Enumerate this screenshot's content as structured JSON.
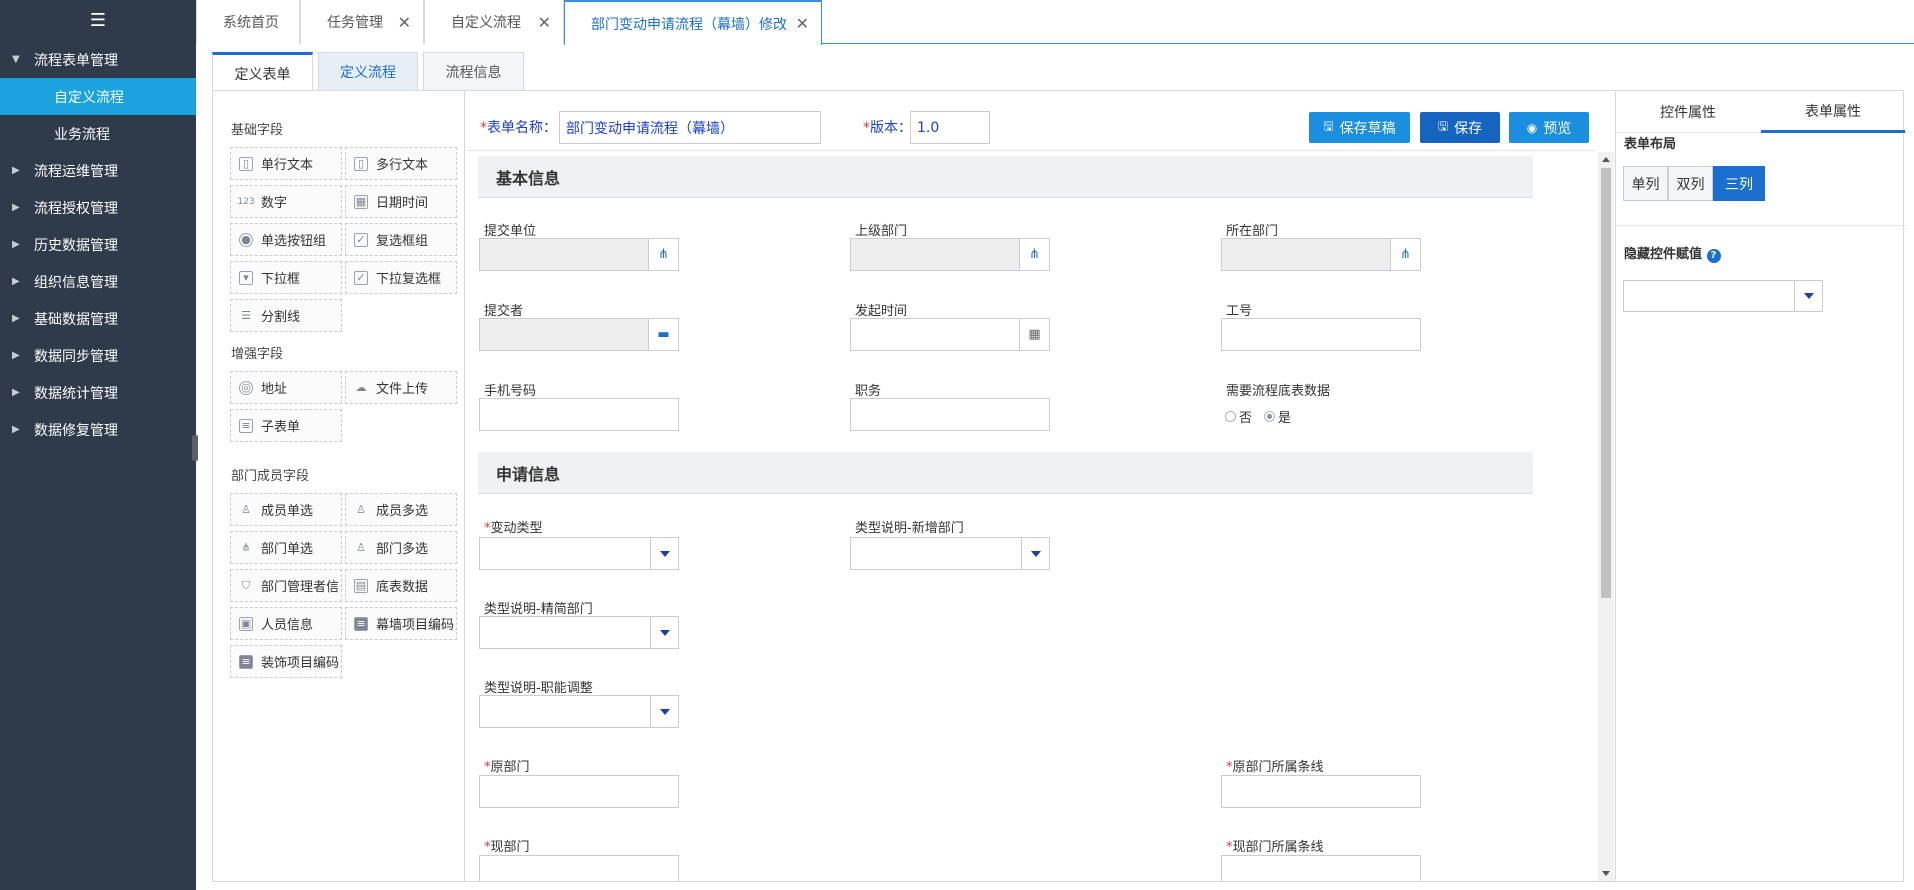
{
  "sidebar": {
    "toggle_icon": "menu-icon",
    "items": [
      {
        "label": "流程表单管理",
        "expanded": true
      },
      {
        "label": "流程运维管理"
      },
      {
        "label": "流程授权管理"
      },
      {
        "label": "历史数据管理"
      },
      {
        "label": "组织信息管理"
      },
      {
        "label": "基础数据管理"
      },
      {
        "label": "数据同步管理"
      },
      {
        "label": "数据统计管理"
      },
      {
        "label": "数据修复管理"
      }
    ],
    "sub_items": [
      {
        "label": "自定义流程",
        "active": true
      },
      {
        "label": "业务流程"
      }
    ]
  },
  "tabs": [
    {
      "label": "系统首页"
    },
    {
      "label": "任务管理"
    },
    {
      "label": "自定义流程"
    },
    {
      "label": "部门变动申请流程（幕墙）修改",
      "active": true
    }
  ],
  "subtabs": [
    {
      "label": "定义表单",
      "active": true
    },
    {
      "label": "定义流程"
    },
    {
      "label": "流程信息"
    }
  ],
  "palette": {
    "groups": [
      {
        "title": "基础字段",
        "fields": [
          "单行文本",
          "多行文本",
          "数字",
          "日期时间",
          "单选按钮组",
          "复选框组",
          "下拉框",
          "下拉复选框",
          "分割线"
        ]
      },
      {
        "title": "增强字段",
        "fields": [
          "地址",
          "文件上传",
          "子表单"
        ]
      },
      {
        "title": "部门成员字段",
        "fields": [
          "成员单选",
          "成员多选",
          "部门单选",
          "部门多选",
          "部门管理者信",
          "底表数据",
          "人员信息",
          "幕墙项目编码",
          "装饰项目编码"
        ]
      }
    ]
  },
  "form_header": {
    "name_label": "表单名称：",
    "name_value": "部门变动申请流程（幕墙）",
    "version_label": "版本：",
    "version_value": "1.0",
    "buttons": {
      "save_draft": "保存草稿",
      "save": "保存",
      "preview": "预览"
    }
  },
  "sections": [
    {
      "title": "基本信息"
    },
    {
      "title": "申请信息"
    }
  ],
  "fields": {
    "submit_unit": "提交单位",
    "parent_dept": "上级部门",
    "current_dept": "所在部门",
    "submitter": "提交者",
    "start_time": "发起时间",
    "employee_no": "工号",
    "phone": "手机号码",
    "position": "职务",
    "need_data": "需要流程底表数据",
    "radio_no": "否",
    "radio_yes": "是",
    "change_type": "变动类型",
    "type_new_dept": "类型说明-新增部门",
    "type_simplify": "类型说明-精简部门",
    "type_function": "类型说明-职能调整",
    "orig_dept": "原部门",
    "orig_dept_line": "原部门所属条线",
    "new_dept": "现部门",
    "new_dept_line": "现部门所属条线"
  },
  "props": {
    "tabs": [
      "控件属性",
      "表单属性"
    ],
    "active_tab": "表单属性",
    "layout_label": "表单布局",
    "layout_options": [
      "单列",
      "双列",
      "三列"
    ],
    "layout_selected": "三列",
    "hidden_label": "隐藏控件赋值"
  },
  "colors": {
    "primary": "#1a6fcf",
    "accent": "#1aa3dd",
    "sidebar": "#2f3a4a",
    "required": "#e4393c"
  }
}
